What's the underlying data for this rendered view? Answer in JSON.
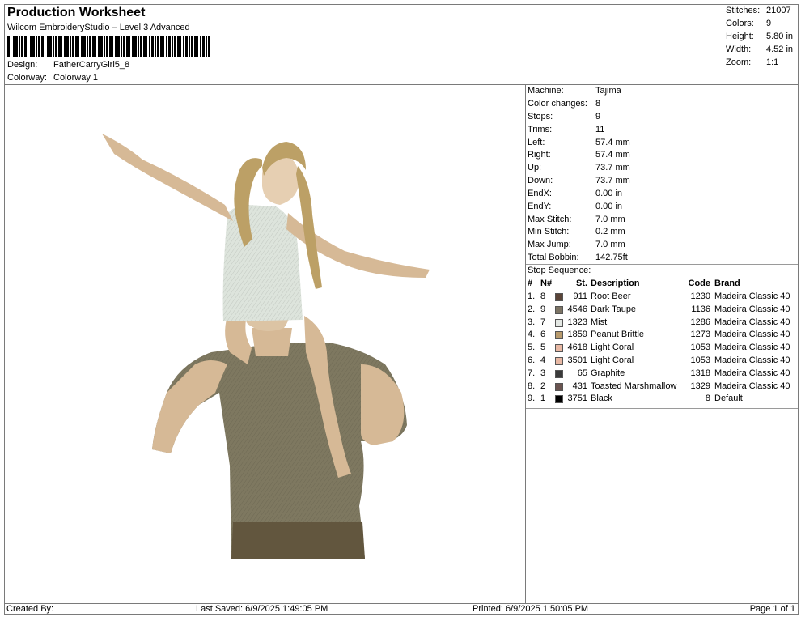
{
  "header": {
    "title": "Production Worksheet",
    "subtitle": "Wilcom EmbroideryStudio – Level 3 Advanced",
    "design_label": "Design:",
    "design_value": "FatherCarryGirl5_8",
    "colorway_label": "Colorway:",
    "colorway_value": "Colorway 1"
  },
  "stats": [
    {
      "label": "Stitches:",
      "value": "21007"
    },
    {
      "label": "Colors:",
      "value": "9"
    },
    {
      "label": "Height:",
      "value": "5.80 in"
    },
    {
      "label": "Width:",
      "value": "4.52 in"
    },
    {
      "label": "Zoom:",
      "value": "1:1"
    }
  ],
  "machine_info": [
    {
      "label": "Machine:",
      "value": "Tajima"
    },
    {
      "label": "Color changes:",
      "value": "8"
    },
    {
      "label": "Stops:",
      "value": "9"
    },
    {
      "label": "Trims:",
      "value": "11"
    },
    {
      "label": "Left:",
      "value": "57.4 mm"
    },
    {
      "label": "Right:",
      "value": "57.4 mm"
    },
    {
      "label": "Up:",
      "value": "73.7 mm"
    },
    {
      "label": "Down:",
      "value": "73.7 mm"
    },
    {
      "label": "EndX:",
      "value": "0.00 in"
    },
    {
      "label": "EndY:",
      "value": "0.00 in"
    },
    {
      "label": "Max Stitch:",
      "value": "7.0 mm"
    },
    {
      "label": "Min Stitch:",
      "value": "0.2 mm"
    },
    {
      "label": "Max Jump:",
      "value": "7.0 mm"
    },
    {
      "label": "Total Bobbin:",
      "value": "142.75ft"
    }
  ],
  "stop_sequence": {
    "title": "Stop Sequence:",
    "headers": {
      "num": "#",
      "n": "N#",
      "st": "St.",
      "desc": "Description",
      "code": "Code",
      "brand": "Brand"
    },
    "rows": [
      {
        "num": "1.",
        "n": "8",
        "color": "#5a4438",
        "st": "911",
        "desc": "Root Beer",
        "code": "1230",
        "brand": "Madeira Classic 40"
      },
      {
        "num": "2.",
        "n": "9",
        "color": "#7c7464",
        "st": "4546",
        "desc": "Dark Taupe",
        "code": "1136",
        "brand": "Madeira Classic 40"
      },
      {
        "num": "3.",
        "n": "7",
        "color": "#e4e8e4",
        "st": "1323",
        "desc": "Mist",
        "code": "1286",
        "brand": "Madeira Classic 40"
      },
      {
        "num": "4.",
        "n": "6",
        "color": "#b89a6c",
        "st": "1859",
        "desc": "Peanut Brittle",
        "code": "1273",
        "brand": "Madeira Classic 40"
      },
      {
        "num": "5.",
        "n": "5",
        "color": "#e8b8a4",
        "st": "4618",
        "desc": "Light Coral",
        "code": "1053",
        "brand": "Madeira Classic 40"
      },
      {
        "num": "6.",
        "n": "4",
        "color": "#e8b8a4",
        "st": "3501",
        "desc": "Light Coral",
        "code": "1053",
        "brand": "Madeira Classic 40"
      },
      {
        "num": "7.",
        "n": "3",
        "color": "#3a3a3a",
        "st": "65",
        "desc": "Graphite",
        "code": "1318",
        "brand": "Madeira Classic 40"
      },
      {
        "num": "8.",
        "n": "2",
        "color": "#6a5450",
        "st": "431",
        "desc": "Toasted Marshmallow",
        "code": "1329",
        "brand": "Madeira Classic 40"
      },
      {
        "num": "9.",
        "n": "1",
        "color": "#000000",
        "st": "3751",
        "desc": "Black",
        "code": "8",
        "brand": "Default"
      }
    ]
  },
  "footer": {
    "created_by": "Created By:",
    "last_saved": "Last Saved: 6/9/2025 1:49:05 PM",
    "printed": "Printed: 6/9/2025 1:50:05 PM",
    "page": "Page 1 of 1"
  }
}
